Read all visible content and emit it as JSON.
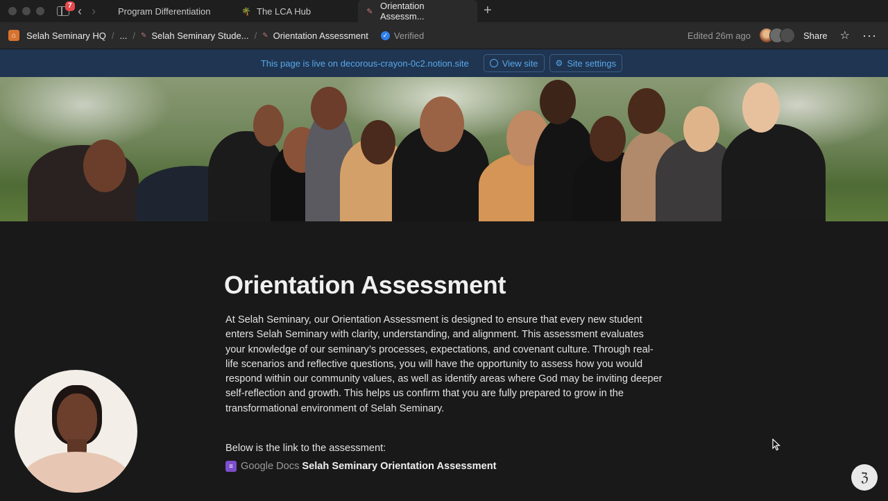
{
  "tabbar": {
    "notification_count": "7",
    "tabs": [
      {
        "label": "Program Differentiation",
        "icon": ""
      },
      {
        "label": "The LCA Hub",
        "icon": "tree-icon"
      },
      {
        "label": "Orientation Assessm...",
        "icon": "page-icon",
        "active": true
      }
    ],
    "new_tab_symbol": "+"
  },
  "breadcrumb": {
    "workspace": "Selah Seminary HQ",
    "ellipsis": "...",
    "parent": "Selah Seminary Stude...",
    "current": "Orientation Assessment",
    "verified": "Verified",
    "edited": "Edited 26m ago",
    "share": "Share"
  },
  "banner": {
    "live_text": "This page is live on decorous-crayon-0c2.notion.site",
    "view_site": "View site",
    "site_settings": "Site settings"
  },
  "page": {
    "title": "Orientation Assessment",
    "paragraph": "At Selah Seminary, our Orientation Assessment is designed to ensure that every new student enters Selah Seminary with clarity, understanding, and alignment. This assessment evaluates your knowledge of our seminary’s processes, expectations, and covenant culture. Through real-life scenarios and reflective questions, you will have the opportunity to assess how you would respond within our community values, as well as identify areas where God may be inviting deeper self-reflection and growth. This helps us confirm that you are fully prepared to grow in the transformational environment of Selah Seminary.",
    "below_text": "Below is the link to the assessment:",
    "link_source": "Google Docs",
    "link_title": "Selah Seminary Orientation Assessment"
  },
  "help_glyph": "ℨ",
  "colors": {
    "background": "#191919",
    "banner_bg": "#1f3551",
    "banner_text": "#5aa8ea",
    "accent_verified": "#2f80ed",
    "doc_icon": "#7c4dcc"
  }
}
